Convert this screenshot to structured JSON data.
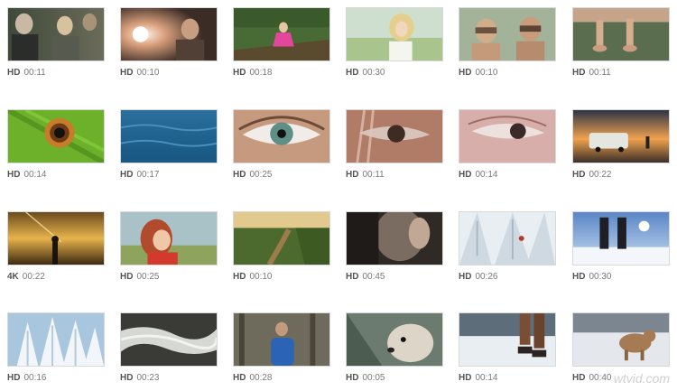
{
  "clips": [
    {
      "quality": "HD",
      "duration": "00:11",
      "scene": "people-talking"
    },
    {
      "quality": "HD",
      "duration": "00:10",
      "scene": "sunlit-forest-couple"
    },
    {
      "quality": "HD",
      "duration": "00:18",
      "scene": "girl-jumping-on-log"
    },
    {
      "quality": "HD",
      "duration": "00:30",
      "scene": "woman-blonde-hair"
    },
    {
      "quality": "HD",
      "duration": "00:10",
      "scene": "children-binoculars"
    },
    {
      "quality": "HD",
      "duration": "00:11",
      "scene": "dangling-feet"
    },
    {
      "quality": "HD",
      "duration": "00:14",
      "scene": "lizard-eye"
    },
    {
      "quality": "HD",
      "duration": "00:17",
      "scene": "blue-water"
    },
    {
      "quality": "HD",
      "duration": "00:25",
      "scene": "eye-closeup"
    },
    {
      "quality": "HD",
      "duration": "00:11",
      "scene": "eye-through-hair"
    },
    {
      "quality": "HD",
      "duration": "00:14",
      "scene": "eye-side-profile"
    },
    {
      "quality": "HD",
      "duration": "00:22",
      "scene": "van-at-sunset"
    },
    {
      "quality": "4K",
      "duration": "00:22",
      "scene": "silhouette-golden-sky"
    },
    {
      "quality": "HD",
      "duration": "00:25",
      "scene": "girl-in-field"
    },
    {
      "quality": "HD",
      "duration": "00:10",
      "scene": "farm-path"
    },
    {
      "quality": "HD",
      "duration": "00:45",
      "scene": "profile-in-shadow"
    },
    {
      "quality": "HD",
      "duration": "00:26",
      "scene": "ice-climber"
    },
    {
      "quality": "HD",
      "duration": "00:30",
      "scene": "snow-hiker-boots"
    },
    {
      "quality": "HD",
      "duration": "00:16",
      "scene": "snowy-trees"
    },
    {
      "quality": "HD",
      "duration": "00:23",
      "scene": "rushing-river"
    },
    {
      "quality": "HD",
      "duration": "00:28",
      "scene": "jogger-in-woods"
    },
    {
      "quality": "HD",
      "duration": "00:05",
      "scene": "dog-portrait"
    },
    {
      "quality": "HD",
      "duration": "00:14",
      "scene": "walking-in-snow"
    },
    {
      "quality": "HD",
      "duration": "00:40",
      "scene": "dog-in-snow"
    }
  ],
  "watermark": "wtvid.com"
}
